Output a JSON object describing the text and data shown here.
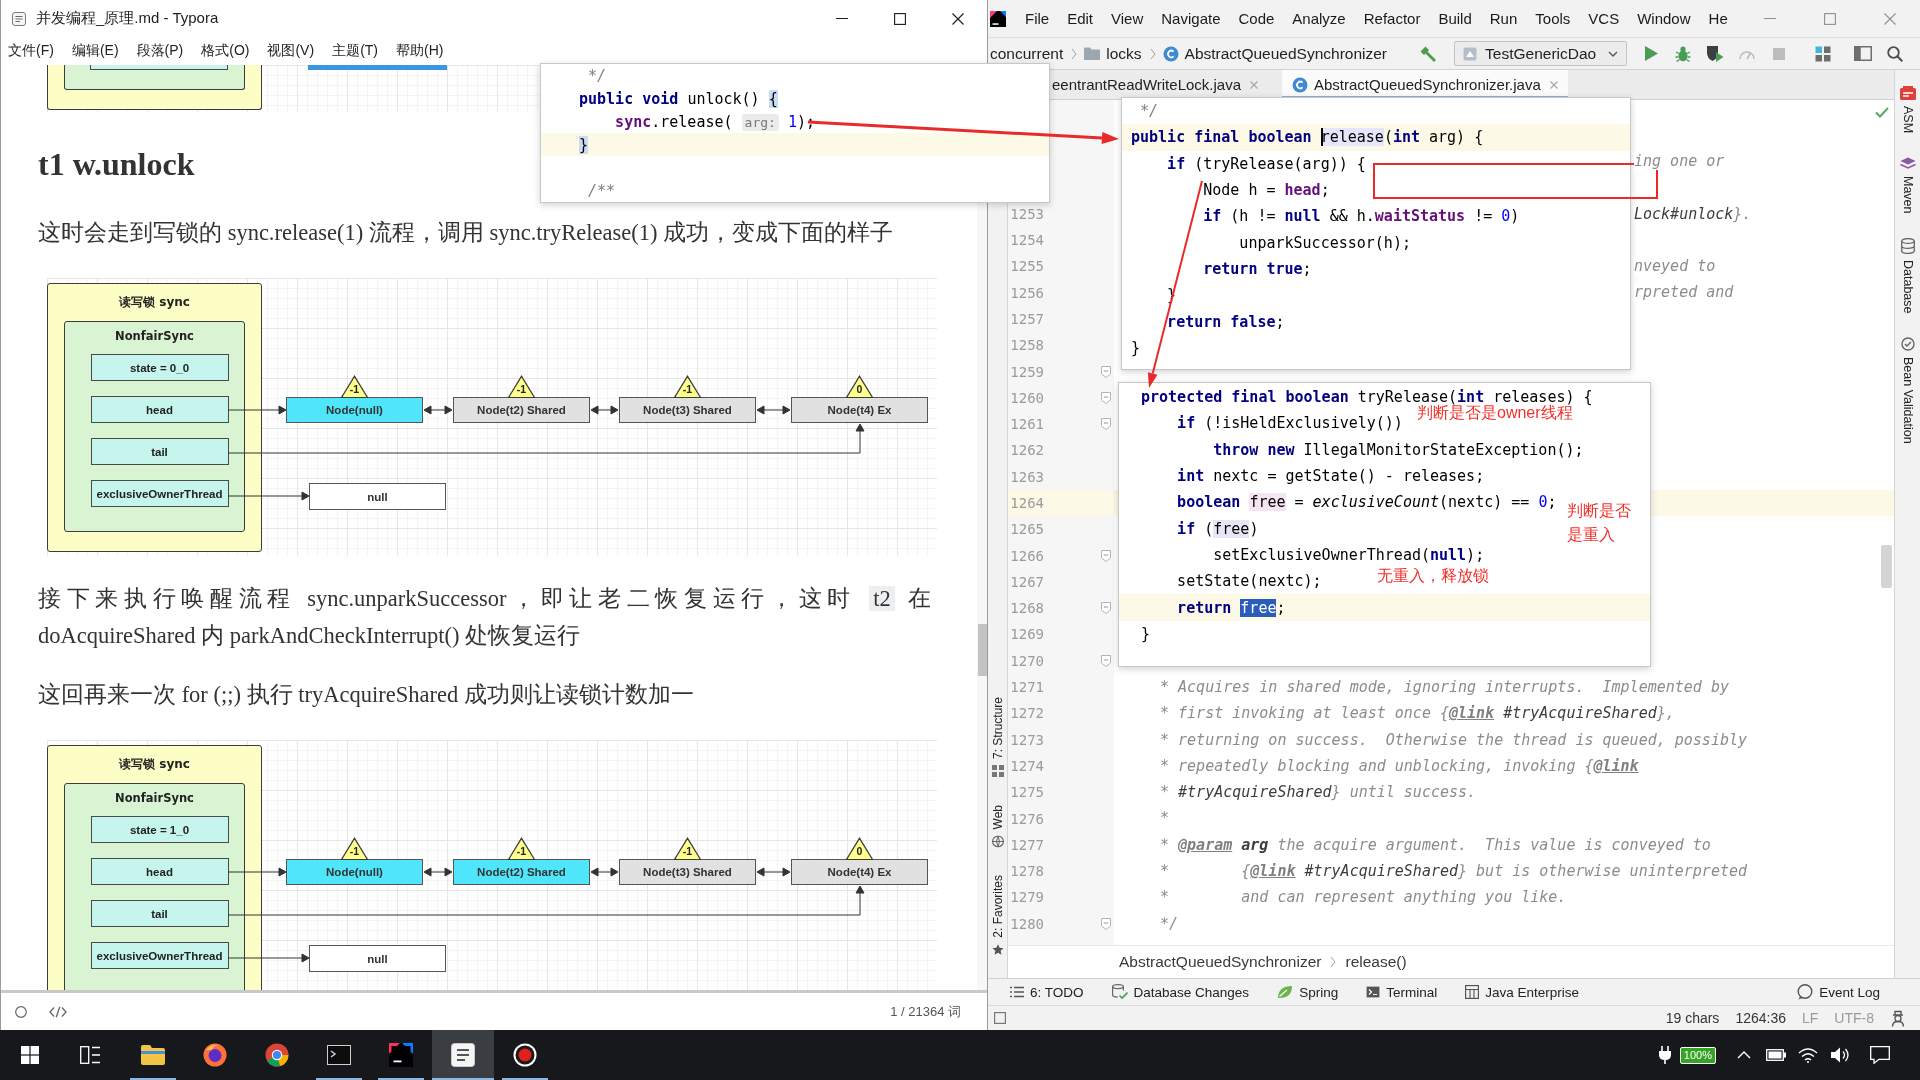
{
  "typora": {
    "title": "并发编程_原理.md - Typora",
    "menu": [
      "文件(F)",
      "编辑(E)",
      "段落(P)",
      "格式(O)",
      "视图(V)",
      "主题(T)",
      "帮助(H)"
    ],
    "blocks": [
      {
        "kind": "diagram_tail"
      },
      {
        "kind": "heading",
        "text": "t1 w.unlock"
      },
      {
        "kind": "paragraph",
        "runs": [
          {
            "kind": "text",
            "text": "这时会走到写锁的 sync.release(1) 流程，调用 sync.tryRelease(1) 成功，变成下面的样子"
          }
        ]
      },
      {
        "kind": "diagram",
        "title": "读写锁 sync",
        "inner": "NonfairSync",
        "fields": [
          "state = 0_0",
          "head",
          "tail",
          "exclusiveOwnerThread"
        ],
        "nodes": [
          {
            "label": "Node(null)",
            "status": "-1",
            "highlighted": true
          },
          {
            "label": "Node(t2) Shared",
            "status": "-1",
            "highlighted": false
          },
          {
            "label": "Node(t3) Shared",
            "status": "-1",
            "highlighted": false
          },
          {
            "label": "Node(t4) Ex",
            "status": "0",
            "highlighted": false
          }
        ],
        "owner": "null"
      },
      {
        "kind": "paragraph",
        "runs": [
          {
            "kind": "text",
            "text": "接下来执行唤醒流程 sync.unparkSuccessor，即让老二恢复运行，这时 "
          },
          {
            "kind": "code",
            "text": "t2"
          },
          {
            "kind": "text",
            "text": " 在 doAcquireShared 内 parkAndCheckInterrupt() 处恢复运行"
          }
        ]
      },
      {
        "kind": "paragraph",
        "runs": [
          {
            "kind": "text",
            "text": "这回再来一次 for (;;) 执行 tryAcquireShared 成功则让读锁计数加一"
          }
        ]
      },
      {
        "kind": "diagram",
        "title": "读写锁 sync",
        "inner": "NonfairSync",
        "fields": [
          "state = 1_0",
          "head",
          "tail",
          "exclusiveOwnerThread"
        ],
        "nodes": [
          {
            "label": "Node(null)",
            "status": "-1",
            "highlighted": true
          },
          {
            "label": "Node(t2) Shared",
            "status": "-1",
            "highlighted": true
          },
          {
            "label": "Node(t3) Shared",
            "status": "-1",
            "highlighted": false
          },
          {
            "label": "Node(t4) Ex",
            "status": "0",
            "highlighted": false
          }
        ],
        "owner": "null"
      }
    ],
    "word_count": "1 / 21364 词"
  },
  "ide": {
    "menu": [
      "File",
      "Edit",
      "View",
      "Navigate",
      "Code",
      "Analyze",
      "Refactor",
      "Build",
      "Run",
      "Tools",
      "VCS",
      "Window",
      "He"
    ],
    "path": [
      {
        "kind": "package",
        "label": "concurrent"
      },
      {
        "kind": "folder",
        "label": "locks"
      },
      {
        "kind": "class",
        "label": "AbstractQueuedSynchronizer"
      }
    ],
    "run_config": "TestGenericDao",
    "toolbar": [
      {
        "disabled": false
      },
      {
        "disabled": false
      },
      {
        "disabled": false
      },
      {
        "disabled": false
      },
      {
        "disabled": true
      },
      {
        "disabled": true
      },
      {
        "disabled": false
      },
      {
        "disabled": false
      },
      {
        "disabled": false
      }
    ],
    "tabs": [
      {
        "kind": "plain",
        "label": "eentrantReadWriteLock.java",
        "selected": false
      },
      {
        "kind": "class",
        "label": "AbstractQueuedSynchronizer.java",
        "selected": true
      }
    ],
    "left_tools": [
      "7: Structure",
      "Web",
      "2: Favorites"
    ],
    "right_tools": [
      "ASM",
      "Maven",
      "Database",
      "Bean Validation"
    ],
    "editor": {
      "rows": [
        {
          "kind": "fragment",
          "current": false,
          "fold": false,
          "tokens": [
            {
              "kind": "doc",
              "text": "ing one or"
            }
          ]
        },
        {
          "kind": "line"
        },
        {
          "kind": "fragment",
          "number": "1253",
          "current": false,
          "fold": false,
          "tokens": [
            {
              "kind": "ref",
              "text": "Lock#unlock"
            },
            {
              "kind": "doc",
              "text": "}."
            }
          ]
        },
        {
          "kind": "line",
          "number": "1254",
          "current": false,
          "fold": false
        },
        {
          "kind": "fragment",
          "number": "1255",
          "current": false,
          "fold": false,
          "tokens": [
            {
              "kind": "doc",
              "text": "nveyed to"
            }
          ]
        },
        {
          "kind": "fragment",
          "number": "1256",
          "current": false,
          "fold": false,
          "tokens": [
            {
              "kind": "doc",
              "text": "rpreted and"
            }
          ]
        },
        {
          "kind": "line",
          "number": "1257",
          "current": false,
          "fold": false
        },
        {
          "kind": "line",
          "number": "1258",
          "current": false,
          "fold": false
        },
        {
          "kind": "line",
          "number": "1259",
          "current": false,
          "fold": true
        },
        {
          "kind": "line",
          "number": "1260",
          "current": false,
          "fold": true
        },
        {
          "kind": "line",
          "number": "1261",
          "current": false,
          "fold": true
        },
        {
          "kind": "line",
          "number": "1262",
          "current": false,
          "fold": false
        },
        {
          "kind": "line",
          "number": "1263",
          "current": false,
          "fold": false
        },
        {
          "kind": "line",
          "number": "1264",
          "current": true,
          "fold": false
        },
        {
          "kind": "line",
          "number": "1265",
          "current": false,
          "fold": false
        },
        {
          "kind": "line",
          "number": "1266",
          "current": false,
          "fold": true
        },
        {
          "kind": "line",
          "number": "1267",
          "current": false,
          "fold": false
        },
        {
          "kind": "line",
          "number": "1268",
          "current": false,
          "fold": true
        },
        {
          "kind": "line",
          "number": "1269",
          "current": false,
          "fold": false
        },
        {
          "kind": "line",
          "number": "1270",
          "current": false,
          "fold": true
        },
        {
          "kind": "line",
          "number": "1271",
          "current": false,
          "fold": false,
          "tokens": [
            {
              "kind": "doc",
              "text": "* Acquires in shared mode, ignoring interrupts.  Implemented by"
            }
          ]
        },
        {
          "kind": "line",
          "number": "1272",
          "current": false,
          "fold": false,
          "tokens": [
            {
              "kind": "doc",
              "text": "* first invoking at least once {"
            },
            {
              "kind": "tag",
              "text": "@link"
            },
            {
              "kind": "ref",
              "text": " #tryAcquireShared"
            },
            {
              "kind": "doc",
              "text": "},"
            }
          ]
        },
        {
          "kind": "line",
          "number": "1273",
          "current": false,
          "fold": false,
          "tokens": [
            {
              "kind": "doc",
              "text": "* returning on success.  Otherwise the thread is queued, possibly"
            }
          ]
        },
        {
          "kind": "line",
          "number": "1274",
          "current": false,
          "fold": false,
          "tokens": [
            {
              "kind": "doc",
              "text": "* repeatedly blocking and unblocking, invoking {"
            },
            {
              "kind": "tag",
              "text": "@link"
            }
          ]
        },
        {
          "kind": "line",
          "number": "1275",
          "current": false,
          "fold": false,
          "tokens": [
            {
              "kind": "doc",
              "text": "* "
            },
            {
              "kind": "ref",
              "text": "#tryAcquireShared"
            },
            {
              "kind": "doc",
              "text": "} until success."
            }
          ]
        },
        {
          "kind": "line",
          "number": "1276",
          "current": false,
          "fold": false,
          "tokens": [
            {
              "kind": "doc",
              "text": "*"
            }
          ]
        },
        {
          "kind": "line",
          "number": "1277",
          "current": false,
          "fold": false,
          "tokens": [
            {
              "kind": "doc",
              "text": "* "
            },
            {
              "kind": "tag",
              "text": "@param"
            },
            {
              "kind": "param",
              "text": " arg"
            },
            {
              "kind": "doc",
              "text": " the acquire argument.  This value is conveyed to"
            }
          ]
        },
        {
          "kind": "line",
          "number": "1278",
          "current": false,
          "fold": false,
          "tokens": [
            {
              "kind": "doc",
              "text": "*        {"
            },
            {
              "kind": "tag",
              "text": "@link"
            },
            {
              "kind": "ref",
              "text": " #tryAcquireShared"
            },
            {
              "kind": "doc",
              "text": "} but is otherwise uninterpreted"
            }
          ]
        },
        {
          "kind": "line",
          "number": "1279",
          "current": false,
          "fold": false,
          "tokens": [
            {
              "kind": "doc",
              "text": "*        and can represent anything you like."
            }
          ]
        },
        {
          "kind": "line",
          "number": "1280",
          "current": false,
          "fold": true,
          "tokens": [
            {
              "kind": "doc",
              "text": "*/"
            }
          ]
        }
      ]
    },
    "breadcrumbs": [
      "AbstractQueuedSynchronizer",
      "release()"
    ],
    "tool_windows": [
      "6: TODO",
      "Database Changes",
      "Spring",
      "Terminal",
      "Java Enterprise"
    ],
    "event_log": "Event Log",
    "status": [
      {
        "text": "19 chars",
        "muted": false
      },
      {
        "text": "1264:36",
        "muted": false
      },
      {
        "text": "LF",
        "muted": true
      },
      {
        "text": "UTF-8",
        "muted": true
      }
    ]
  },
  "popups": [
    {
      "lines": [
        {
          "current": false,
          "tokens": [
            {
              "kind": "comment",
              "text": " */"
            }
          ]
        },
        {
          "current": false,
          "tokens": [
            {
              "kind": "kw",
              "text": "public void "
            },
            {
              "kind": "plain",
              "text": "unlock() "
            },
            {
              "kind": "brace",
              "text": "{"
            }
          ]
        },
        {
          "current": false,
          "tokens": [
            {
              "kind": "field",
              "text": "    sync"
            },
            {
              "kind": "plain",
              "text": ".release( "
            },
            {
              "kind": "hint",
              "text": "arg:"
            },
            {
              "kind": "num",
              "text": " 1"
            },
            {
              "kind": "plain",
              "text": ");"
            }
          ]
        },
        {
          "current": true,
          "tokens": [
            {
              "kind": "brace",
              "text": "}"
            }
          ]
        },
        {
          "current": false
        },
        {
          "current": false,
          "tokens": [
            {
              "kind": "comment",
              "text": " /**"
            }
          ]
        }
      ]
    },
    {
      "lines": [
        {
          "current": false,
          "tokens": [
            {
              "kind": "comment",
              "text": " */"
            }
          ]
        },
        {
          "current": true,
          "tokens": [
            {
              "kind": "kw",
              "text": "public final boolean "
            },
            {
              "kind": "usage",
              "text": "release",
              "caret": true
            },
            {
              "kind": "plain",
              "text": "("
            },
            {
              "kind": "kw",
              "text": "int"
            },
            {
              "kind": "plain",
              "text": " arg) {"
            }
          ]
        },
        {
          "current": false,
          "tokens": [
            {
              "kind": "kw",
              "text": "    if"
            },
            {
              "kind": "plain",
              "text": " (tryRelease(arg)) {"
            }
          ]
        },
        {
          "current": false,
          "tokens": [
            {
              "kind": "plain",
              "text": "        Node h = "
            },
            {
              "kind": "field",
              "text": "head"
            },
            {
              "kind": "plain",
              "text": ";"
            }
          ]
        },
        {
          "current": false,
          "tokens": [
            {
              "kind": "kw",
              "text": "        if"
            },
            {
              "kind": "plain",
              "text": " (h != "
            },
            {
              "kind": "kw",
              "text": "null"
            },
            {
              "kind": "plain",
              "text": " && h."
            },
            {
              "kind": "field",
              "text": "waitStatus"
            },
            {
              "kind": "plain",
              "text": " != "
            },
            {
              "kind": "num",
              "text": "0"
            },
            {
              "kind": "plain",
              "text": ")"
            }
          ]
        },
        {
          "current": false,
          "tokens": [
            {
              "kind": "plain",
              "text": "            unparkSuccessor(h);"
            }
          ]
        },
        {
          "current": false,
          "tokens": [
            {
              "kind": "kw",
              "text": "        return true"
            },
            {
              "kind": "plain",
              "text": ";"
            }
          ]
        },
        {
          "current": false,
          "tokens": [
            {
              "kind": "plain",
              "text": "    }"
            }
          ]
        },
        {
          "current": false,
          "tokens": [
            {
              "kind": "kw",
              "text": "    return false"
            },
            {
              "kind": "plain",
              "text": ";"
            }
          ]
        },
        {
          "current": false,
          "tokens": [
            {
              "kind": "plain",
              "text": "}"
            }
          ]
        }
      ]
    },
    {
      "lines": [
        {
          "current": false,
          "tokens": [
            {
              "kind": "kw",
              "text": "protected final boolean "
            },
            {
              "kind": "plain",
              "text": "tryRelease("
            },
            {
              "kind": "kw",
              "text": "int"
            },
            {
              "kind": "plain",
              "text": " releases) {"
            }
          ]
        },
        {
          "current": false,
          "tokens": [
            {
              "kind": "kw",
              "text": "    if"
            },
            {
              "kind": "plain",
              "text": " (!isHeldExclusively())"
            }
          ]
        },
        {
          "current": false,
          "tokens": [
            {
              "kind": "kw",
              "text": "        throw new"
            },
            {
              "kind": "plain",
              "text": " IllegalMonitorStateException();"
            }
          ]
        },
        {
          "current": false,
          "tokens": [
            {
              "kind": "kw",
              "text": "    int"
            },
            {
              "kind": "plain",
              "text": " nextc = getState() - releases;"
            }
          ]
        },
        {
          "current": false,
          "tokens": [
            {
              "kind": "kw",
              "text": "    boolean "
            },
            {
              "kind": "write",
              "text": "free"
            },
            {
              "kind": "plain",
              "text": " = "
            },
            {
              "kind": "italic",
              "text": "exclusiveCount"
            },
            {
              "kind": "plain",
              "text": "(nextc) == "
            },
            {
              "kind": "num",
              "text": "0"
            },
            {
              "kind": "plain",
              "text": ";"
            }
          ]
        },
        {
          "current": false,
          "tokens": [
            {
              "kind": "kw",
              "text": "    if"
            },
            {
              "kind": "plain",
              "text": " ("
            },
            {
              "kind": "read",
              "text": "free"
            },
            {
              "kind": "plain",
              "text": ")"
            }
          ]
        },
        {
          "current": false,
          "tokens": [
            {
              "kind": "plain",
              "text": "        setExclusiveOwnerThread("
            },
            {
              "kind": "kw",
              "text": "null"
            },
            {
              "kind": "plain",
              "text": ");"
            }
          ]
        },
        {
          "current": false,
          "tokens": [
            {
              "kind": "plain",
              "text": "    setState(nextc);"
            }
          ]
        },
        {
          "current": true,
          "tokens": [
            {
              "kind": "kw",
              "text": "    return "
            },
            {
              "kind": "selected",
              "text": "free"
            },
            {
              "kind": "plain",
              "text": ";"
            }
          ]
        },
        {
          "current": false,
          "tokens": [
            {
              "kind": "plain",
              "text": "}"
            }
          ]
        }
      ]
    }
  ],
  "notes": [
    "判断是否是owner线程",
    "判断是否是重入",
    "无重入，释放锁"
  ],
  "taskbar": {
    "apps": [
      {
        "running": true,
        "selected": false
      },
      {
        "running": false,
        "selected": false
      },
      {
        "running": false,
        "selected": false
      },
      {
        "running": true,
        "selected": false
      },
      {
        "running": true,
        "selected": false
      },
      {
        "running": true,
        "selected": true
      },
      {
        "running": true,
        "selected": false
      }
    ],
    "battery": "100%"
  }
}
